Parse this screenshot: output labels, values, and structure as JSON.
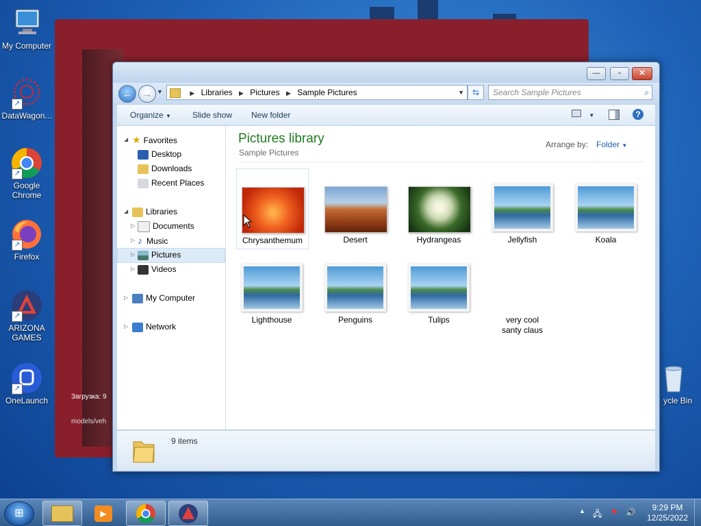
{
  "desktop": {
    "icons": [
      {
        "label": "My Computer",
        "icon": "computer-icon"
      },
      {
        "label": "DataWagon...",
        "icon": "datawagon-icon"
      },
      {
        "label": "Google Chrome",
        "icon": "chrome-icon"
      },
      {
        "label": "Firefox",
        "icon": "firefox-icon"
      },
      {
        "label": "ARIZONA GAMES",
        "icon": "arizona-games-icon"
      },
      {
        "label": "OneLaunch",
        "icon": "onelaunch-icon"
      },
      {
        "label": "ycle Bin",
        "icon": "recycle-bin-icon"
      }
    ],
    "background_text_1": "Загрузка: 9",
    "background_text_2": "models/veh"
  },
  "window": {
    "buttons": {
      "minimize": "—",
      "maximize": "▫",
      "close": "✕"
    },
    "address": [
      "Libraries",
      "Pictures",
      "Sample Pictures"
    ],
    "search_placeholder": "Search Sample Pictures",
    "toolbar": {
      "organize": "Organize",
      "slideshow": "Slide show",
      "new_folder": "New folder"
    },
    "nav": {
      "favorites": "Favorites",
      "desktop": "Desktop",
      "downloads": "Downloads",
      "recent": "Recent Places",
      "libraries": "Libraries",
      "documents": "Documents",
      "music": "Music",
      "pictures": "Pictures",
      "videos": "Videos",
      "computer": "My Computer",
      "network": "Network"
    },
    "content": {
      "title": "Pictures library",
      "subtitle": "Sample Pictures",
      "arrange_label": "Arrange by:",
      "arrange_value": "Folder"
    },
    "items": [
      {
        "name": "Chrysanthemum",
        "thumb": "chrysanthemum"
      },
      {
        "name": "Desert",
        "thumb": "desert"
      },
      {
        "name": "Hydrangeas",
        "thumb": "hydrangeas"
      },
      {
        "name": "Jellyfish",
        "thumb": "landscape-placeholder"
      },
      {
        "name": "Koala",
        "thumb": "landscape-placeholder"
      },
      {
        "name": "Lighthouse",
        "thumb": "landscape-placeholder"
      },
      {
        "name": "Penguins",
        "thumb": "landscape-placeholder"
      },
      {
        "name": "Tulips",
        "thumb": "landscape-placeholder"
      },
      {
        "name": "very cool santy claus",
        "thumb": "none"
      }
    ],
    "status": "9 items"
  },
  "taskbar": {
    "clock_time": "9:29 PM",
    "clock_date": "12/25/2022",
    "pinned": [
      "explorer-icon",
      "media-player-icon",
      "chrome-icon",
      "arizona-games-icon"
    ]
  }
}
